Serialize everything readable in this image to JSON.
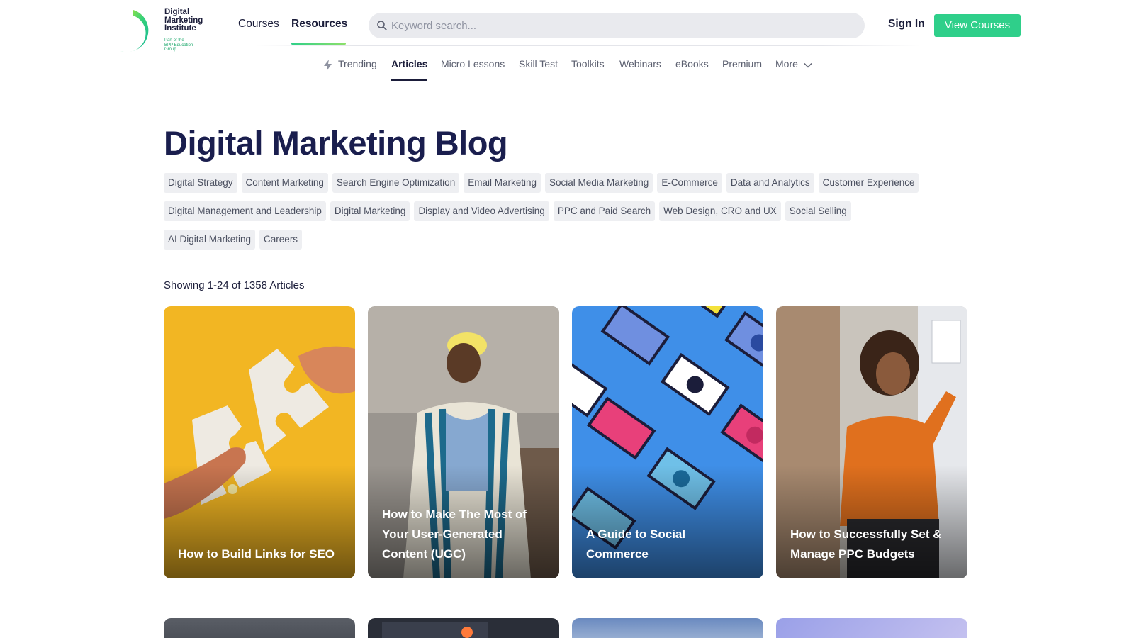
{
  "logo": {
    "name_line1": "Digital",
    "name_line2": "Marketing",
    "name_line3": "Institute",
    "sub_line1": "Part of the",
    "sub_line2": "BPP Education",
    "sub_line3": "Group"
  },
  "header": {
    "nav": [
      "Courses",
      "Resources"
    ],
    "active_nav": "Resources",
    "search_placeholder": "Keyword search...",
    "search_value": "",
    "sign_in": "Sign In",
    "cta": "View Courses",
    "cta_color": "#2fcf8a"
  },
  "subnav": {
    "items": [
      "Trending",
      "Articles",
      "Micro Lessons",
      "Skill Test",
      "Toolkits",
      "Webinars",
      "eBooks",
      "Premium",
      "More"
    ],
    "active": "Articles"
  },
  "page": {
    "title": "Digital Marketing Blog",
    "showing": "Showing 1-24 of 1358 Articles"
  },
  "tags": {
    "row1": [
      "Digital Strategy",
      "Content Marketing",
      "Search Engine Optimization",
      "Email Marketing",
      "Social Media Marketing",
      "E-Commerce",
      "Data and Analytics",
      "Customer Experience"
    ],
    "row2": [
      "Digital Management and Leadership",
      "Digital Marketing",
      "Display and Video Advertising",
      "PPC and Paid Search",
      "Web Design, CRO and UX",
      "Social Selling"
    ],
    "row3": [
      "AI Digital Marketing",
      "Careers"
    ]
  },
  "articles": [
    {
      "title": "How to Build Links for SEO"
    },
    {
      "title": "How to Make The Most of Your User-Generated Content (UGC)"
    },
    {
      "title": "A Guide to Social Commerce"
    },
    {
      "title": "How to Successfully Set & Manage PPC Budgets"
    }
  ]
}
